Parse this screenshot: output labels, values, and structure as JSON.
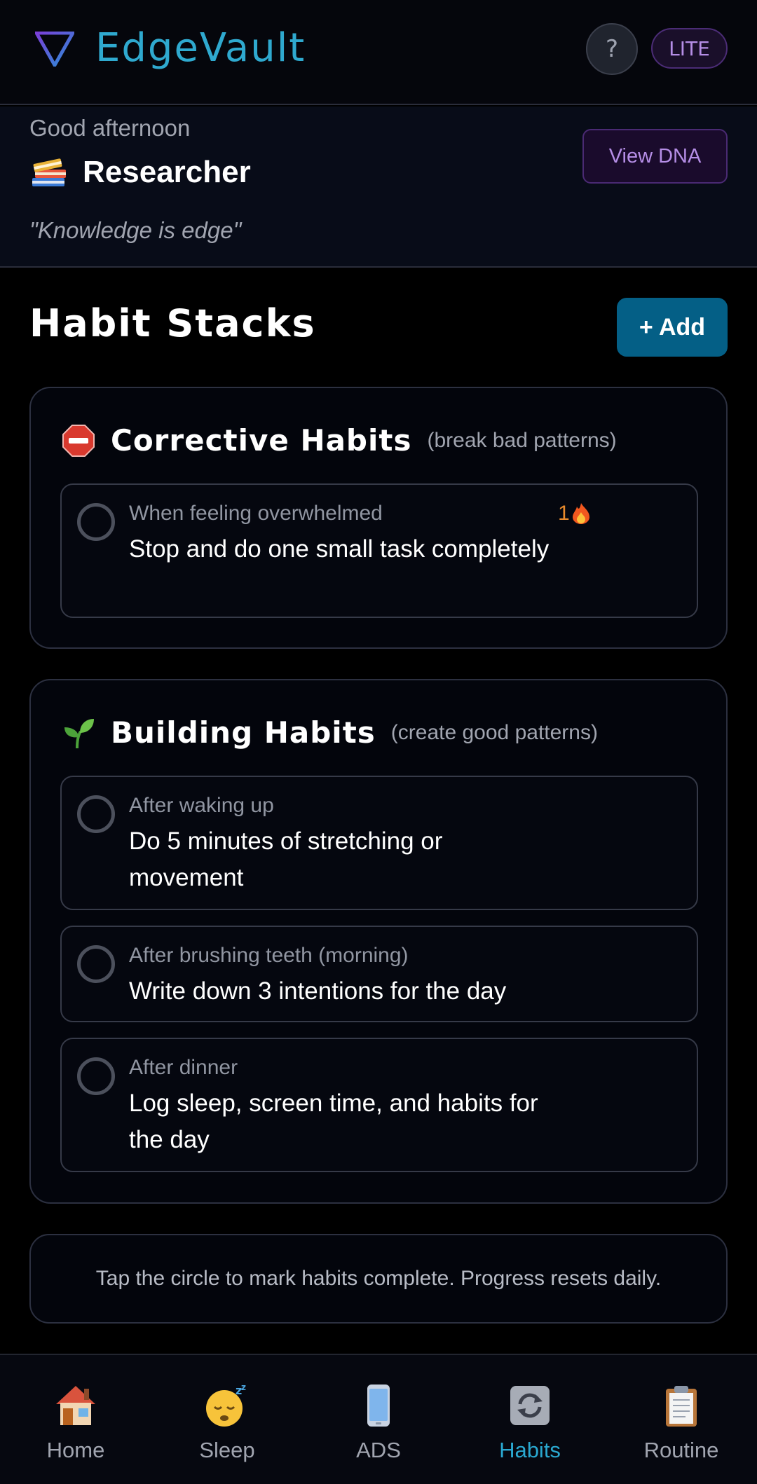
{
  "header": {
    "app_name": "EdgeVault",
    "help_label": "?",
    "plan_badge": "LITE"
  },
  "greeting": {
    "salutation": "Good afternoon",
    "persona_name": "Researcher",
    "persona_icon": "books-icon",
    "quote": "\"Knowledge is edge\"",
    "dna_button": "View DNA"
  },
  "main": {
    "title": "Habit Stacks",
    "add_button": "+ Add",
    "stacks": [
      {
        "icon": "stop-sign-icon",
        "title": "Corrective Habits",
        "subtitle": "(break bad patterns)",
        "habits": [
          {
            "trigger": "When feeling overwhelmed",
            "action": "Stop and do one small task completely",
            "streak": "1",
            "completed": false
          }
        ]
      },
      {
        "icon": "seedling-icon",
        "title": "Building Habits",
        "subtitle": "(create good patterns)",
        "habits": [
          {
            "trigger": "After waking up",
            "action": "Do 5 minutes of stretching or movement",
            "completed": false
          },
          {
            "trigger": "After brushing teeth (morning)",
            "action": "Write down 3 intentions for the day",
            "completed": false
          },
          {
            "trigger": "After dinner",
            "action": "Log sleep, screen time, and habits for the day",
            "completed": false
          }
        ]
      }
    ],
    "tip": "Tap the circle to mark habits complete. Progress resets daily."
  },
  "nav": {
    "items": [
      {
        "label": "Home",
        "icon": "house-icon",
        "active": false
      },
      {
        "label": "Sleep",
        "icon": "sleeping-face-icon",
        "active": false
      },
      {
        "label": "ADS",
        "icon": "phone-icon",
        "active": false
      },
      {
        "label": "Habits",
        "icon": "repeat-icon",
        "active": true
      },
      {
        "label": "Routine",
        "icon": "clipboard-icon",
        "active": false
      }
    ]
  },
  "colors": {
    "accent": "#2fa9cf",
    "add_button_bg": "#045f86",
    "purple_accent": "#b58ee6",
    "streak": "#e88a2c",
    "background": "#000000"
  }
}
